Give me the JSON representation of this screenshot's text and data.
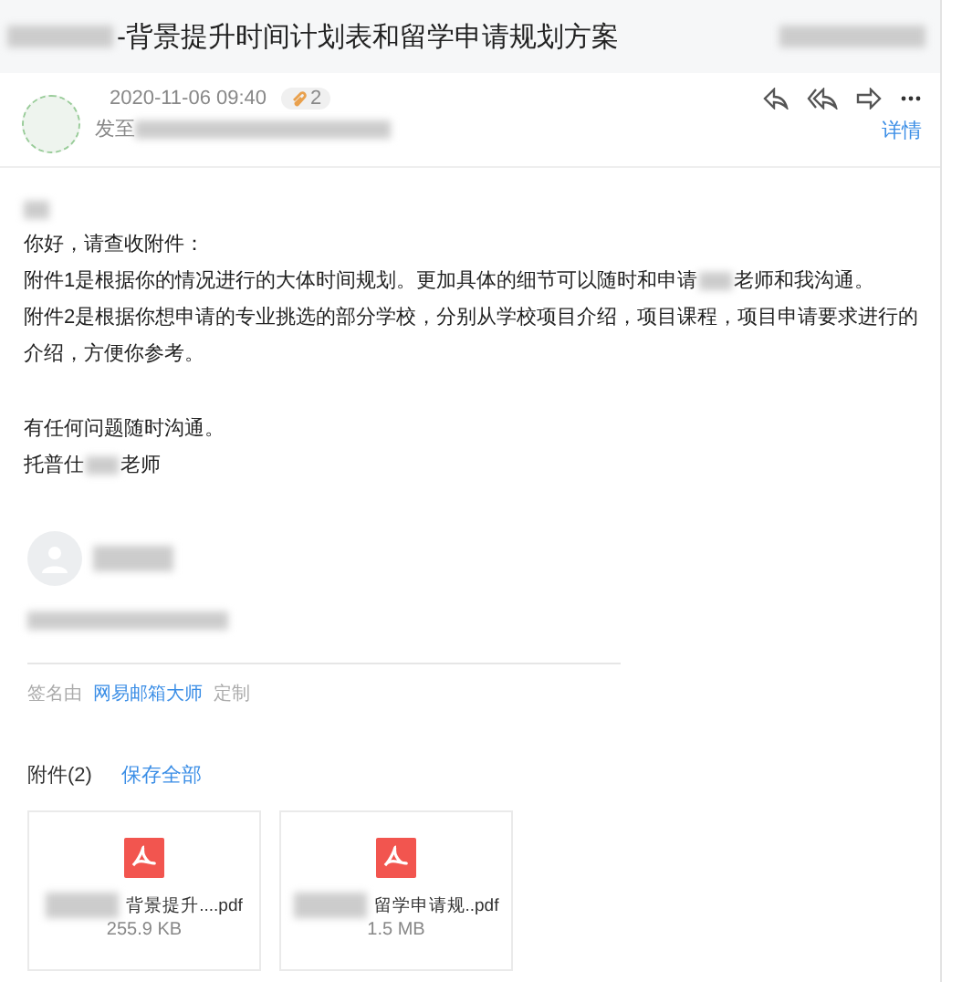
{
  "subject": "-背景提升时间计划表和留学申请规划方案",
  "message": {
    "date": "2020-11-06 09:40",
    "attachment_count": "2",
    "to_label": "发至",
    "details_link": "详情"
  },
  "body": {
    "lines": [
      {
        "parts": [
          "你好，请查收附件："
        ]
      },
      {
        "parts": [
          "附件1是根据你的情况进行的大体时间规划。更加具体的细节可以随时和申请",
          "老师和我沟通。"
        ]
      },
      {
        "parts": [
          "附件2是根据你想申请的专业挑选的部分学校，分别从学校项目介绍，项目课程，项目申请要求进行的介绍，方便你参考。"
        ]
      },
      {
        "kind": "blank"
      },
      {
        "parts": [
          "有任何问题随时沟通。"
        ]
      },
      {
        "parts": [
          "托普仕",
          "老师"
        ]
      }
    ]
  },
  "signature": {
    "prefix": "签名由",
    "link": "网易邮箱大师",
    "suffix": "定制"
  },
  "attachments": {
    "title": "附件(2)",
    "save_all": "保存全部",
    "files": [
      {
        "name": "背景提升....pdf",
        "size": "255.9 KB"
      },
      {
        "name": "留学申请规..pdf",
        "size": "1.5 MB"
      }
    ]
  }
}
